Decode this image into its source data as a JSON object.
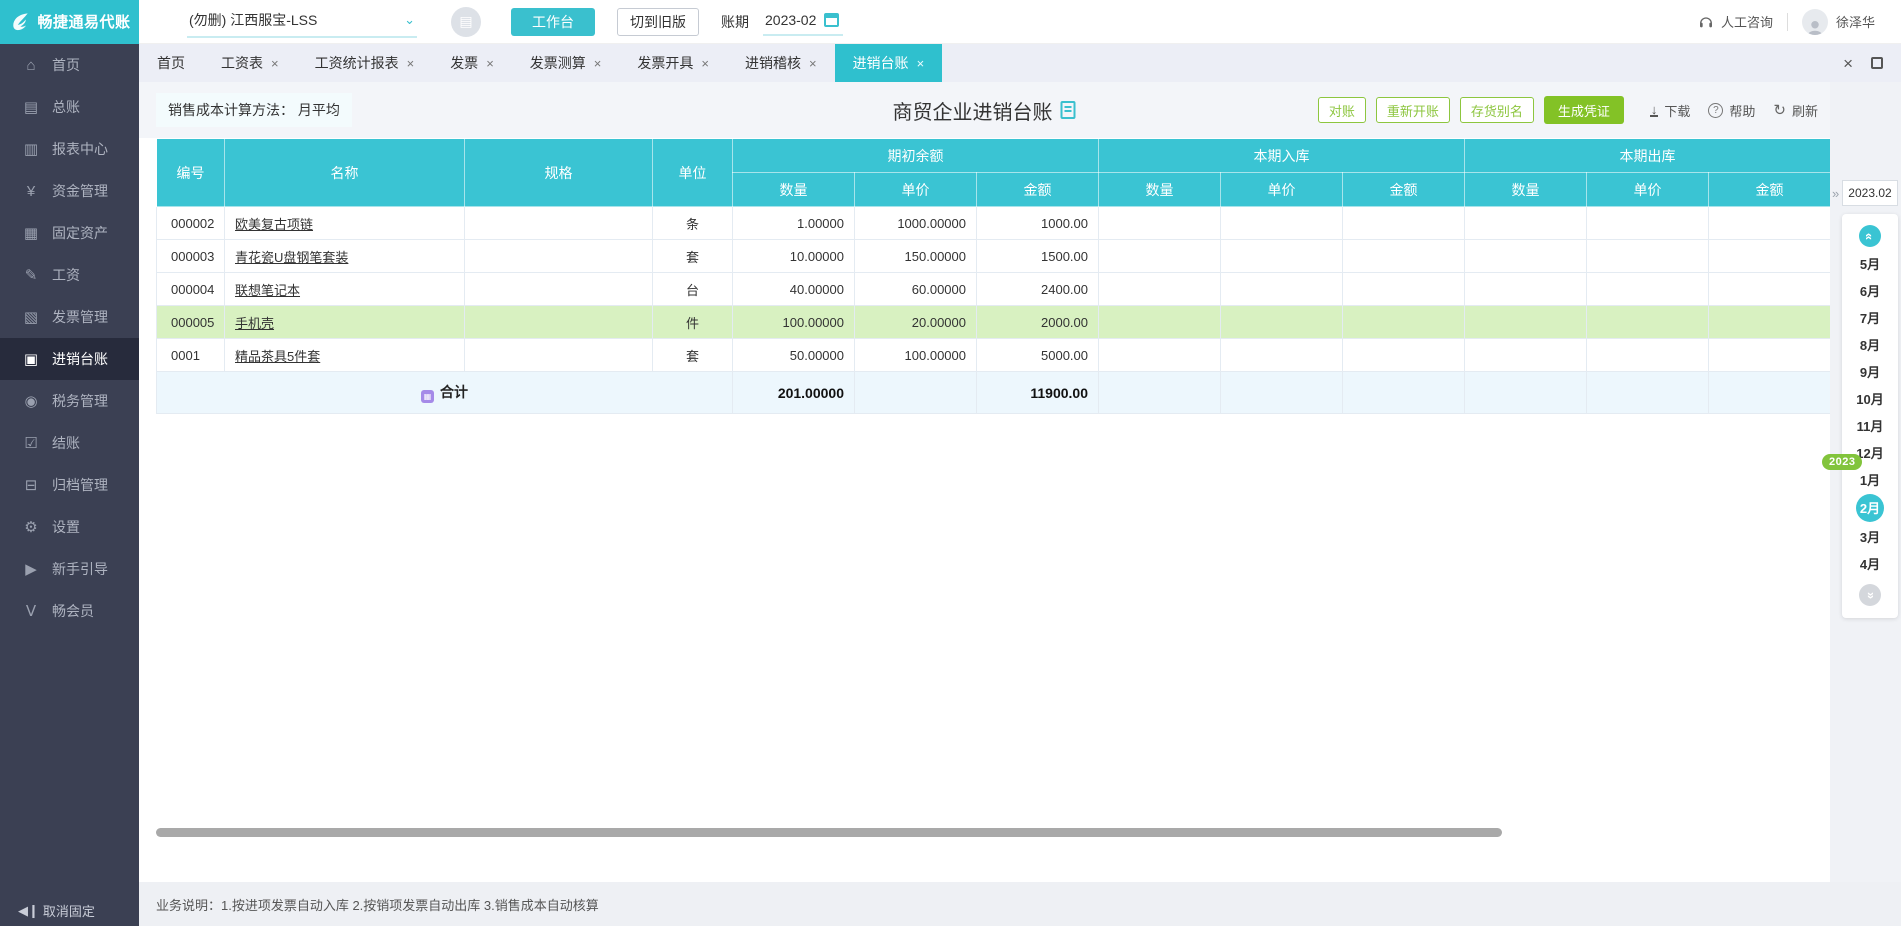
{
  "topbar": {
    "logo_text": "畅捷通易代账",
    "company": "(勿删) 江西服宝-LSS",
    "workbench_label": "工作台",
    "switch_old_label": "切到旧版",
    "period_label": "账期",
    "period_value": "2023-02",
    "consult_label": "人工咨询",
    "username": "徐泽华"
  },
  "sidebar": {
    "items": [
      {
        "label": "首页"
      },
      {
        "label": "总账"
      },
      {
        "label": "报表中心"
      },
      {
        "label": "资金管理"
      },
      {
        "label": "固定资产"
      },
      {
        "label": "工资"
      },
      {
        "label": "发票管理"
      },
      {
        "label": "进销台账"
      },
      {
        "label": "税务管理"
      },
      {
        "label": "结账"
      },
      {
        "label": "归档管理"
      },
      {
        "label": "设置"
      },
      {
        "label": "新手引导"
      },
      {
        "label": "畅会员"
      }
    ],
    "unpin_label": "取消固定"
  },
  "tabs": {
    "items": [
      {
        "label": "首页"
      },
      {
        "label": "工资表"
      },
      {
        "label": "工资统计报表"
      },
      {
        "label": "发票"
      },
      {
        "label": "发票测算"
      },
      {
        "label": "发票开具"
      },
      {
        "label": "进销稽核"
      },
      {
        "label": "进销台账"
      }
    ]
  },
  "toolbar": {
    "cost_method_label": "销售成本计算方法：",
    "cost_method_value": "月平均",
    "title": "商贸企业进销台账",
    "buttons": [
      "对账",
      "重新开账",
      "存货别名"
    ],
    "primary_button": "生成凭证",
    "download_label": "下载",
    "help_label": "帮助",
    "refresh_label": "刷新"
  },
  "table": {
    "columns": [
      "编号",
      "名称",
      "规格",
      "单位"
    ],
    "groups": [
      {
        "label": "期初余额",
        "sub": [
          "数量",
          "单价",
          "金额"
        ]
      },
      {
        "label": "本期入库",
        "sub": [
          "数量",
          "单价",
          "金额"
        ]
      },
      {
        "label": "本期出库",
        "sub": [
          "数量",
          "单价",
          "金额"
        ]
      }
    ],
    "rows": [
      [
        "000002",
        "欧美复古项链",
        "",
        "条",
        "1.00000",
        "1000.00000",
        "1000.00",
        "",
        "",
        "",
        "",
        "",
        ""
      ],
      [
        "000003",
        "青花瓷U盘钢笔套装",
        "",
        "套",
        "10.00000",
        "150.00000",
        "1500.00",
        "",
        "",
        "",
        "",
        "",
        ""
      ],
      [
        "000004",
        "联想笔记本",
        "",
        "台",
        "40.00000",
        "60.00000",
        "2400.00",
        "",
        "",
        "",
        "",
        "",
        ""
      ],
      [
        "000005",
        "手机壳",
        "",
        "件",
        "100.00000",
        "20.00000",
        "2000.00",
        "",
        "",
        "",
        "",
        "",
        ""
      ],
      [
        "0001",
        "精品茶具5件套",
        "",
        "套",
        "50.00000",
        "100.00000",
        "5000.00",
        "",
        "",
        "",
        "",
        "",
        ""
      ]
    ],
    "total": {
      "label": "合计",
      "qty": "201.00000",
      "amount": "11900.00"
    }
  },
  "month_panel": {
    "current": "2023.02",
    "year_badge": "2023",
    "months": [
      "5月",
      "6月",
      "7月",
      "8月",
      "9月",
      "10月",
      "11月",
      "12月",
      "1月",
      "2月",
      "3月",
      "4月"
    ]
  },
  "statusbar": {
    "note": "业务说明：1.按进项发票自动入库   2.按销项发票自动出库   3.销售成本自动核算"
  }
}
